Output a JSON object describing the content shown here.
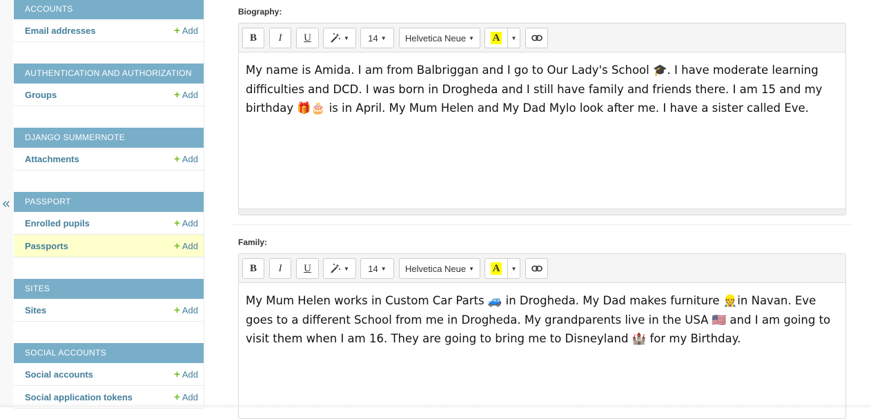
{
  "sidebar": {
    "collapse_glyph": "«",
    "modules": [
      {
        "title": "ACCOUNTS",
        "rows": [
          {
            "label": "Email addresses",
            "add": "Add"
          }
        ]
      },
      {
        "title": "AUTHENTICATION AND AUTHORIZATION",
        "rows": [
          {
            "label": "Groups",
            "add": "Add"
          }
        ]
      },
      {
        "title": "DJANGO SUMMERNOTE",
        "rows": [
          {
            "label": "Attachments",
            "add": "Add"
          }
        ]
      },
      {
        "title": "PASSPORT",
        "rows": [
          {
            "label": "Enrolled pupils",
            "add": "Add"
          },
          {
            "label": "Passports",
            "add": "Add",
            "current": true
          }
        ]
      },
      {
        "title": "SITES",
        "rows": [
          {
            "label": "Sites",
            "add": "Add"
          }
        ]
      },
      {
        "title": "SOCIAL ACCOUNTS",
        "rows": [
          {
            "label": "Social accounts",
            "add": "Add"
          },
          {
            "label": "Social application tokens",
            "add": "Add"
          }
        ]
      }
    ]
  },
  "toolbar": {
    "bold": "B",
    "italic": "I",
    "underline": "U",
    "font_size": "14",
    "font_name": "Helvetica Neue",
    "color_letter": "A",
    "highlight_color": "#ffff00"
  },
  "fields": {
    "biography": {
      "label": "Biography:",
      "content": "My name is Amida. I am from Balbriggan and I go to Our Lady's School 🎓. I have moderate learning difficulties and DCD. I was born in Drogheda and I still have family and friends there. I am 15 and my birthday 🎁🎂 is in April.  My Mum Helen and My Dad Mylo look after me. I have a sister called Eve."
    },
    "family": {
      "label": "Family:",
      "content": "My Mum Helen works in Custom Car Parts 🚙 in Drogheda. My Dad makes furniture 👷in Navan. Eve goes to a different School from me in Drogheda. My grandparents live in the USA 🇺🇸 and I am going to visit them when I am 16. They are going to bring me to Disneyland 🏰 for my Birthday."
    }
  },
  "colors": {
    "module_header": "#79aec8",
    "link": "#447e9b",
    "add_plus": "#70bf2b",
    "current_row": "#ffffcc"
  }
}
